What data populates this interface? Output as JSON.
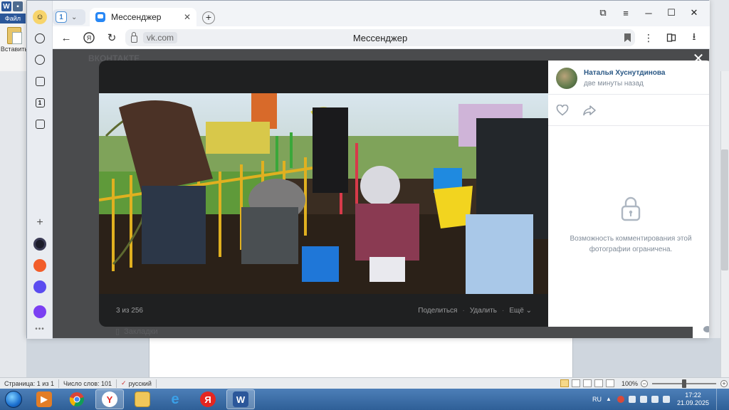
{
  "word": {
    "file_tab": "Файл",
    "paste_label": "Вставить",
    "status": {
      "page": "Страница: 1 из 1",
      "words": "Число слов: 101",
      "language": "русский",
      "zoom": "100%",
      "zoom_minus": "−",
      "zoom_plus": "+"
    }
  },
  "browser": {
    "tab_count": "1",
    "active_tab_title": "Мессенджер",
    "new_tab": "+",
    "domain": "vk.com",
    "page_title": "Мессенджер",
    "window_controls": [
      "⧉",
      "≡",
      "─",
      "☐",
      "✕"
    ]
  },
  "vk": {
    "logo_ghost": "ВКОНТАКТЕ",
    "bookmarks_ghost": "Закладки",
    "viewer": {
      "counter": "3 из 256",
      "share": "Поделиться",
      "delete": "Удалить",
      "more": "Ещё",
      "dot": "·",
      "close": "✕"
    },
    "author": {
      "name": "Наталья Хуснутдинова",
      "time": "две минуты назад"
    },
    "comments_restricted": "Возможность комментирования этой фотографии ограничена."
  },
  "taskbar": {
    "lang": "RU",
    "time": "17:22",
    "date": "21.09.2025",
    "yandex_letter": "Я",
    "word_letter": "W"
  },
  "colors": {
    "vk_link": "#2a5885",
    "vk_gray": "#818c99",
    "viewer_bg": "#1f2021",
    "overlay_bg": "#4a4b4d"
  }
}
